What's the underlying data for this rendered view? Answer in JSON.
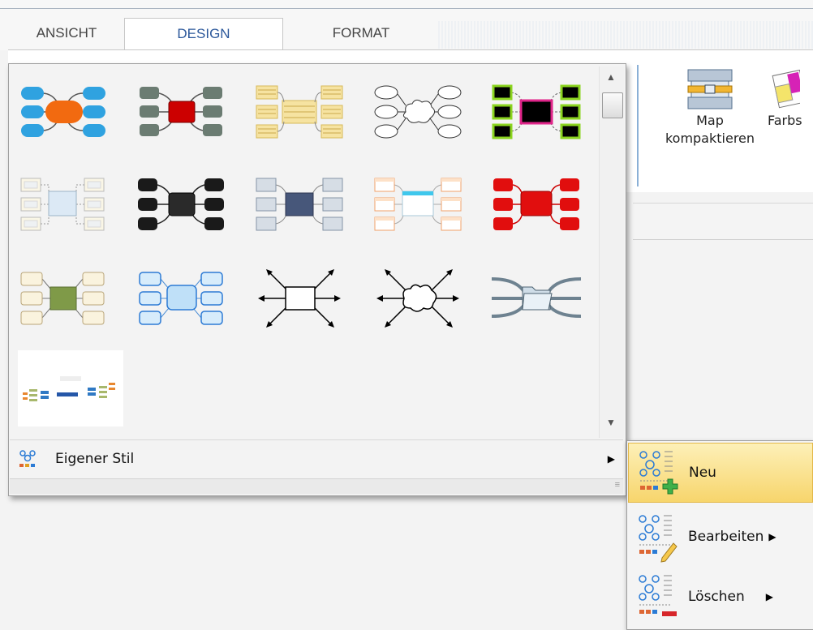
{
  "tabs": [
    {
      "label": "ANSICHT"
    },
    {
      "label": "DESIGN"
    },
    {
      "label": "FORMAT"
    }
  ],
  "ribbon": {
    "compact_map": {
      "line1": "Map",
      "line2": "kompaktieren"
    },
    "color_scheme": {
      "label": "Farbs"
    }
  },
  "gallery": {
    "thumbnails": [
      {
        "name": "style-blue-orange"
      },
      {
        "name": "style-gray-red"
      },
      {
        "name": "style-yellow-lines"
      },
      {
        "name": "style-cloud-outline"
      },
      {
        "name": "style-green-black"
      },
      {
        "name": "style-light-boxes"
      },
      {
        "name": "style-black"
      },
      {
        "name": "style-slate-blue"
      },
      {
        "name": "style-light-cyan"
      },
      {
        "name": "style-red"
      },
      {
        "name": "style-olive-cream"
      },
      {
        "name": "style-light-blue"
      },
      {
        "name": "style-arrows-box"
      },
      {
        "name": "style-arrows-cloud"
      },
      {
        "name": "style-folder"
      },
      {
        "name": "style-custom-preview"
      }
    ]
  },
  "custom_style": {
    "label": "Eigener Stil"
  },
  "submenu": {
    "items": [
      {
        "label": "Neu"
      },
      {
        "label": "Bearbeiten"
      },
      {
        "label": "Löschen"
      }
    ]
  },
  "colors": {
    "accent": "#2b579a",
    "highlight": "#f7d56c"
  }
}
